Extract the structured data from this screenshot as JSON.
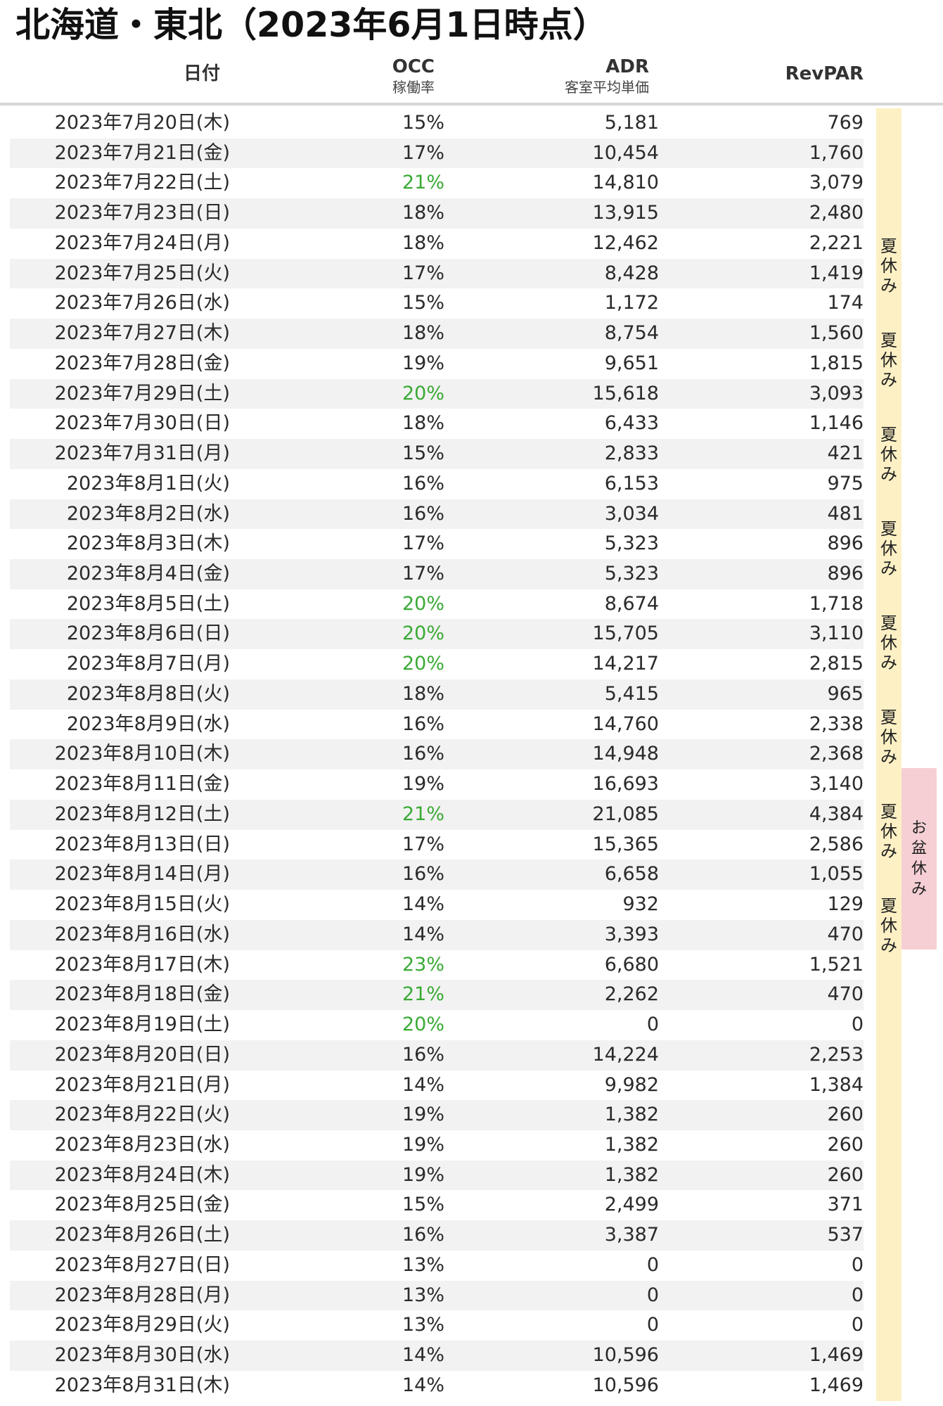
{
  "title": "北海道・東北（2023年6月1日時点）",
  "header": {
    "date": "日付",
    "occ": "OCC",
    "occ_sub": "稼働率",
    "adr": "ADR",
    "adr_sub": "客室平均単価",
    "revpar": "RevPAR"
  },
  "colors": {
    "occ_highlight": "#3aaa35",
    "summer_band": "#fdf0c4",
    "obon_band": "#f5cfd3"
  },
  "rows": [
    {
      "date": "2023年7月20日(木)",
      "occ": "15%",
      "adr": "5,181",
      "revpar": "769",
      "highlight": false
    },
    {
      "date": "2023年7月21日(金)",
      "occ": "17%",
      "adr": "10,454",
      "revpar": "1,760",
      "highlight": false
    },
    {
      "date": "2023年7月22日(土)",
      "occ": "21%",
      "adr": "14,810",
      "revpar": "3,079",
      "highlight": true
    },
    {
      "date": "2023年7月23日(日)",
      "occ": "18%",
      "adr": "13,915",
      "revpar": "2,480",
      "highlight": false
    },
    {
      "date": "2023年7月24日(月)",
      "occ": "18%",
      "adr": "12,462",
      "revpar": "2,221",
      "highlight": false
    },
    {
      "date": "2023年7月25日(火)",
      "occ": "17%",
      "adr": "8,428",
      "revpar": "1,419",
      "highlight": false
    },
    {
      "date": "2023年7月26日(水)",
      "occ": "15%",
      "adr": "1,172",
      "revpar": "174",
      "highlight": false
    },
    {
      "date": "2023年7月27日(木)",
      "occ": "18%",
      "adr": "8,754",
      "revpar": "1,560",
      "highlight": false
    },
    {
      "date": "2023年7月28日(金)",
      "occ": "19%",
      "adr": "9,651",
      "revpar": "1,815",
      "highlight": false
    },
    {
      "date": "2023年7月29日(土)",
      "occ": "20%",
      "adr": "15,618",
      "revpar": "3,093",
      "highlight": true
    },
    {
      "date": "2023年7月30日(日)",
      "occ": "18%",
      "adr": "6,433",
      "revpar": "1,146",
      "highlight": false
    },
    {
      "date": "2023年7月31日(月)",
      "occ": "15%",
      "adr": "2,833",
      "revpar": "421",
      "highlight": false
    },
    {
      "date": "2023年8月1日(火)",
      "occ": "16%",
      "adr": "6,153",
      "revpar": "975",
      "highlight": false
    },
    {
      "date": "2023年8月2日(水)",
      "occ": "16%",
      "adr": "3,034",
      "revpar": "481",
      "highlight": false
    },
    {
      "date": "2023年8月3日(木)",
      "occ": "17%",
      "adr": "5,323",
      "revpar": "896",
      "highlight": false
    },
    {
      "date": "2023年8月4日(金)",
      "occ": "17%",
      "adr": "5,323",
      "revpar": "896",
      "highlight": false
    },
    {
      "date": "2023年8月5日(土)",
      "occ": "20%",
      "adr": "8,674",
      "revpar": "1,718",
      "highlight": true
    },
    {
      "date": "2023年8月6日(日)",
      "occ": "20%",
      "adr": "15,705",
      "revpar": "3,110",
      "highlight": true
    },
    {
      "date": "2023年8月7日(月)",
      "occ": "20%",
      "adr": "14,217",
      "revpar": "2,815",
      "highlight": true
    },
    {
      "date": "2023年8月8日(火)",
      "occ": "18%",
      "adr": "5,415",
      "revpar": "965",
      "highlight": false
    },
    {
      "date": "2023年8月9日(水)",
      "occ": "16%",
      "adr": "14,760",
      "revpar": "2,338",
      "highlight": false
    },
    {
      "date": "2023年8月10日(木)",
      "occ": "16%",
      "adr": "14,948",
      "revpar": "2,368",
      "highlight": false
    },
    {
      "date": "2023年8月11日(金)",
      "occ": "19%",
      "adr": "16,693",
      "revpar": "3,140",
      "highlight": false
    },
    {
      "date": "2023年8月12日(土)",
      "occ": "21%",
      "adr": "21,085",
      "revpar": "4,384",
      "highlight": true
    },
    {
      "date": "2023年8月13日(日)",
      "occ": "17%",
      "adr": "15,365",
      "revpar": "2,586",
      "highlight": false
    },
    {
      "date": "2023年8月14日(月)",
      "occ": "16%",
      "adr": "6,658",
      "revpar": "1,055",
      "highlight": false
    },
    {
      "date": "2023年8月15日(火)",
      "occ": "14%",
      "adr": "932",
      "revpar": "129",
      "highlight": false
    },
    {
      "date": "2023年8月16日(水)",
      "occ": "14%",
      "adr": "3,393",
      "revpar": "470",
      "highlight": false
    },
    {
      "date": "2023年8月17日(木)",
      "occ": "23%",
      "adr": "6,680",
      "revpar": "1,521",
      "highlight": true
    },
    {
      "date": "2023年8月18日(金)",
      "occ": "21%",
      "adr": "2,262",
      "revpar": "470",
      "highlight": true
    },
    {
      "date": "2023年8月19日(土)",
      "occ": "20%",
      "adr": "0",
      "revpar": "0",
      "highlight": true
    },
    {
      "date": "2023年8月20日(日)",
      "occ": "16%",
      "adr": "14,224",
      "revpar": "2,253",
      "highlight": false
    },
    {
      "date": "2023年8月21日(月)",
      "occ": "14%",
      "adr": "9,982",
      "revpar": "1,384",
      "highlight": false
    },
    {
      "date": "2023年8月22日(火)",
      "occ": "19%",
      "adr": "1,382",
      "revpar": "260",
      "highlight": false
    },
    {
      "date": "2023年8月23日(水)",
      "occ": "19%",
      "adr": "1,382",
      "revpar": "260",
      "highlight": false
    },
    {
      "date": "2023年8月24日(木)",
      "occ": "19%",
      "adr": "1,382",
      "revpar": "260",
      "highlight": false
    },
    {
      "date": "2023年8月25日(金)",
      "occ": "15%",
      "adr": "2,499",
      "revpar": "371",
      "highlight": false
    },
    {
      "date": "2023年8月26日(土)",
      "occ": "16%",
      "adr": "3,387",
      "revpar": "537",
      "highlight": false
    },
    {
      "date": "2023年8月27日(日)",
      "occ": "13%",
      "adr": "0",
      "revpar": "0",
      "highlight": false
    },
    {
      "date": "2023年8月28日(月)",
      "occ": "13%",
      "adr": "0",
      "revpar": "0",
      "highlight": false
    },
    {
      "date": "2023年8月29日(火)",
      "occ": "13%",
      "adr": "0",
      "revpar": "0",
      "highlight": false
    },
    {
      "date": "2023年8月30日(水)",
      "occ": "14%",
      "adr": "10,596",
      "revpar": "1,469",
      "highlight": false
    },
    {
      "date": "2023年8月31日(木)",
      "occ": "14%",
      "adr": "10,596",
      "revpar": "1,469",
      "highlight": false
    }
  ],
  "summer_labels": [
    "夏\n休\nみ",
    "夏\n休\nみ",
    "夏\n休\nみ",
    "夏\n休\nみ",
    "夏\n休\nみ",
    "夏\n休\nみ",
    "夏\n休\nみ",
    "夏\n休\nみ"
  ],
  "obon_label": "お\n盆\n休\nみ"
}
